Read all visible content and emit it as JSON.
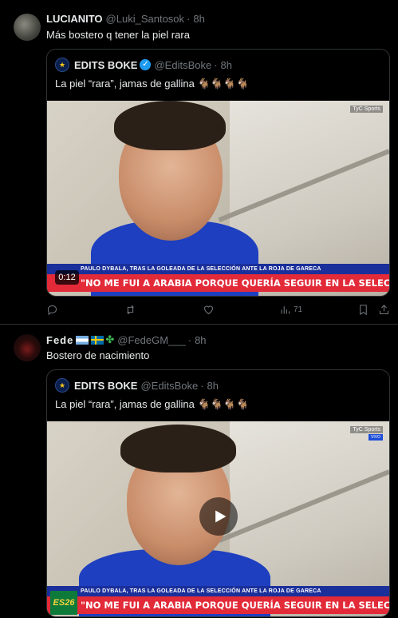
{
  "tweet1": {
    "name": "LUCIANITO",
    "handle": "@Luki_Santosok",
    "time": "8h",
    "text": "Más bostero q tener la piel rara",
    "quote": {
      "name": "EDITS BOKE",
      "handle": "@EditsBoke",
      "time": "8h",
      "text": "La piel “rara”, jamas de gallina 🐐🐐🐐🐐",
      "video": {
        "lower_top": "PAULO DYBALA, TRAS LA GOLEADA DE LA SELECCIÓN ANTE LA ROJA DE GARECA",
        "lower_main": "\"NO ME FUI A ARABIA PORQUE QUERÍA SEGUIR EN LA SELECCIÓN\"",
        "channel": "TyC Sports",
        "duration": "0:12"
      }
    },
    "actions": {
      "reply_icon": "reply-icon",
      "retweet_icon": "retweet-icon",
      "like_icon": "heart-icon",
      "views_icon": "views-icon",
      "views_count": "71",
      "bookmark_icon": "bookmark-icon",
      "share_icon": "share-icon"
    }
  },
  "tweet2": {
    "name": "Fede",
    "clover": "✤",
    "handle": "@FedeGM___",
    "time": "8h",
    "text": "Bostero de nacimiento",
    "quote": {
      "name": "EDITS BOKE",
      "handle": "@EditsBoke",
      "time": "8h",
      "text": "La piel “rara”, jamas de gallina 🐐🐐🐐🐐",
      "video": {
        "lower_top": "PAULO DYBALA, TRAS LA GOLEADA DE LA SELECCIÓN ANTE LA ROJA DE GARECA",
        "lower_main": "\"NO ME FUI A ARABIA PORQUE QUERÍA SEGUIR EN LA SELECCIÓN\"",
        "channel": "TyC Sports",
        "live": "VIVO",
        "badge": "ES26"
      }
    }
  },
  "dot": "·",
  "colors": {
    "background": "#000000",
    "text": "#e7e9ea",
    "muted": "#71767b",
    "border": "#2f3336",
    "verified": "#1d9bf0",
    "banner_red": "#e22a38",
    "banner_blue": "#1a2f9a"
  }
}
